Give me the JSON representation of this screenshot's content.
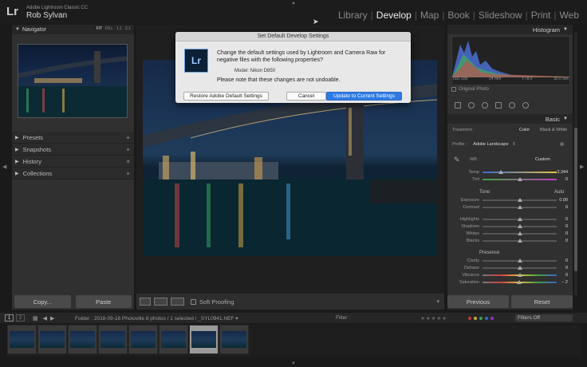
{
  "app": {
    "logo": "Lr",
    "product_name": "Adobe Lightroom Classic CC",
    "user_name": "Rob Sylvan"
  },
  "modules": [
    "Library",
    "Develop",
    "Map",
    "Book",
    "Slideshow",
    "Print",
    "Web"
  ],
  "active_module": "Develop",
  "navigator": {
    "title": "Navigator",
    "zoom_options": [
      "FIT",
      "FILL",
      "1:1",
      "2:1"
    ],
    "active_zoom": "FIT"
  },
  "left_sections": [
    {
      "label": "Presets",
      "action": "+"
    },
    {
      "label": "Snapshots",
      "action": "+"
    },
    {
      "label": "History",
      "action": "×"
    },
    {
      "label": "Collections",
      "action": "+"
    }
  ],
  "left_buttons": {
    "copy": "Copy...",
    "paste": "Paste"
  },
  "toolbar": {
    "soft_proofing": "Soft Proofing"
  },
  "dialog": {
    "title": "Set Default Develop Settings",
    "icon_text": "Lr",
    "message": "Change the default settings used by Lightroom and Camera Raw for negative files with the following properties?",
    "model": "Model:  Nikon D850",
    "warning": "Please note that these changes are not undoable.",
    "buttons": {
      "restore": "Restore Adobe Default Settings",
      "cancel": "Cancel",
      "update": "Update to Current Settings"
    }
  },
  "histogram": {
    "title": "Histogram",
    "iso": "ISO 100",
    "focal": "24 mm",
    "aperture": "f / 8.0",
    "shutter": "30.0 sec",
    "original_photo": "Original Photo"
  },
  "basic": {
    "title": "Basic",
    "treatment_label": "Treatment :",
    "treatment_color": "Color",
    "treatment_bw": "Black & White",
    "profile_label": "Profile :",
    "profile_value": "Adobe Landscape",
    "wb_label": "WB :",
    "wb_value": "Custom",
    "tone_label": "Tone",
    "tone_auto": "Auto",
    "presence_label": "Presence",
    "sliders": [
      {
        "label": "Temp",
        "value": "3,344",
        "pos": 0.25
      },
      {
        "label": "Tint",
        "value": "0",
        "pos": 0.5
      },
      {
        "label": "Exposure",
        "value": "0.00",
        "pos": 0.5
      },
      {
        "label": "Contrast",
        "value": "0",
        "pos": 0.5
      },
      {
        "label": "Highlights",
        "value": "0",
        "pos": 0.5
      },
      {
        "label": "Shadows",
        "value": "0",
        "pos": 0.5
      },
      {
        "label": "Whites",
        "value": "0",
        "pos": 0.5
      },
      {
        "label": "Blacks",
        "value": "0",
        "pos": 0.5
      },
      {
        "label": "Clarity",
        "value": "0",
        "pos": 0.5
      },
      {
        "label": "Dehaze",
        "value": "0",
        "pos": 0.5
      },
      {
        "label": "Vibrance",
        "value": "0",
        "pos": 0.5
      },
      {
        "label": "Saturation",
        "value": "− 2",
        "pos": 0.49
      }
    ]
  },
  "right_buttons": {
    "previous": "Previous",
    "reset": "Reset"
  },
  "filmstrip": {
    "page1": "1",
    "page2": "2",
    "info": "Folder : 2018-09-16 Photoville      8 photos / 1 selected / _SYL0941.NEF ▾",
    "filter_label": "Filter :",
    "stars": "★★★★★",
    "filters_off": "Filters Off",
    "thumbnail_count": 8,
    "selected_index": 6
  },
  "colors": {
    "accent_blue": "#2f7be3",
    "panel_bg": "#303030"
  }
}
